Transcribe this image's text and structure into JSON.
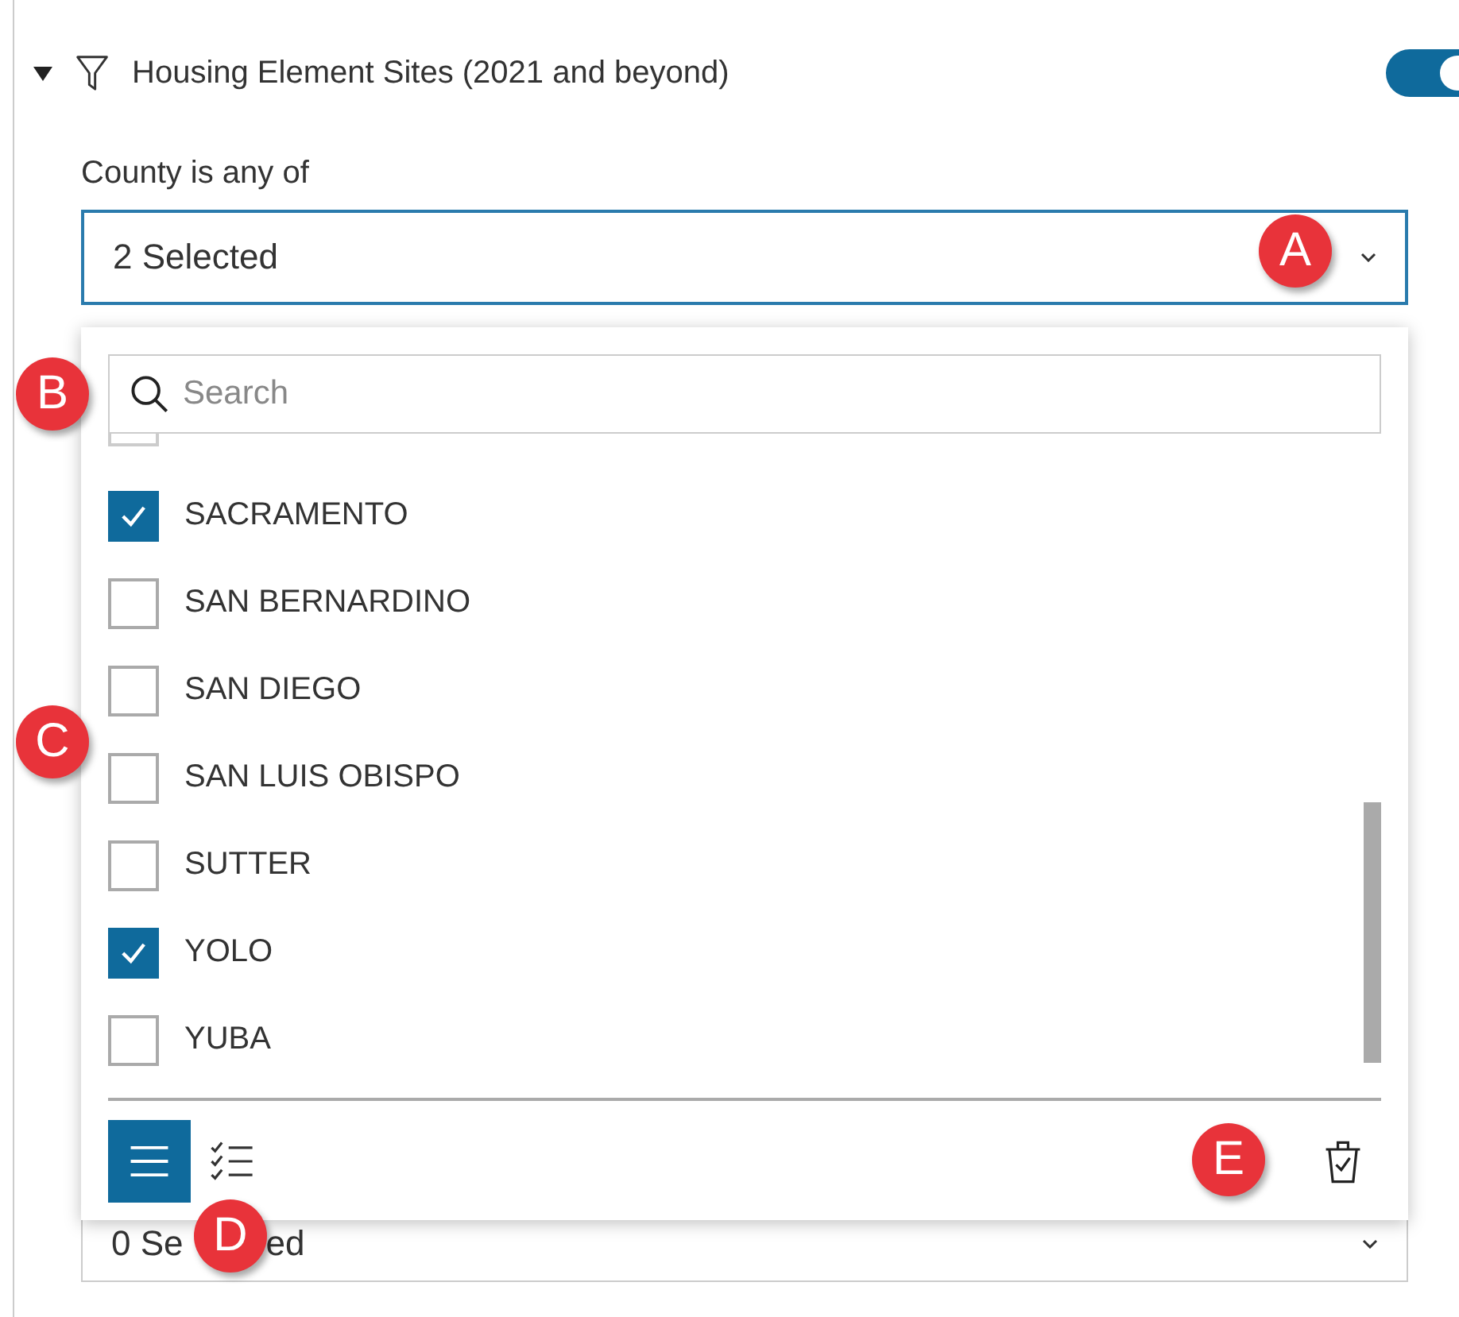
{
  "layer": {
    "expanded": true,
    "title": "Housing Element Sites (2021 and beyond)",
    "enabled": true
  },
  "filter": {
    "label": "County is any of",
    "value": "2 Selected",
    "open": true
  },
  "dropdown": {
    "search": {
      "placeholder": "Search"
    },
    "options": [
      {
        "label": "SACRAMENTO",
        "checked": true
      },
      {
        "label": "SAN BERNARDINO",
        "checked": false
      },
      {
        "label": "SAN DIEGO",
        "checked": false
      },
      {
        "label": "SAN LUIS OBISPO",
        "checked": false
      },
      {
        "label": "SUTTER",
        "checked": false
      },
      {
        "label": "YOLO",
        "checked": true
      },
      {
        "label": "YUBA",
        "checked": false
      }
    ],
    "view_modes": [
      {
        "kind": "list",
        "selected": true
      },
      {
        "kind": "checklist",
        "selected": false
      }
    ]
  },
  "next_filter": {
    "value_parts": [
      "0 Se",
      "ed"
    ]
  },
  "callouts": [
    "A",
    "B",
    "C",
    "D",
    "E"
  ]
}
